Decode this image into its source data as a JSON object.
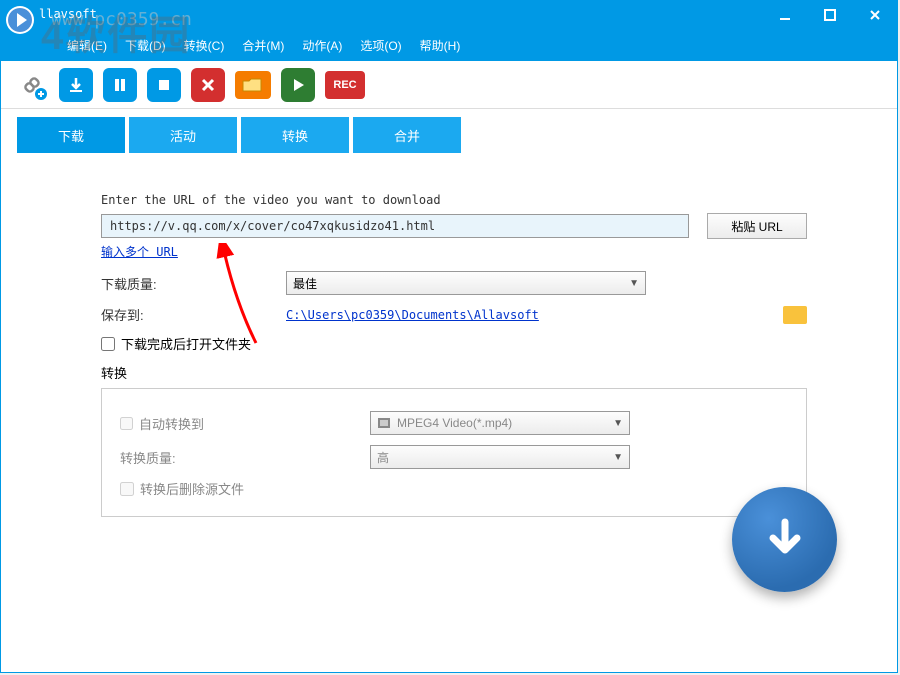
{
  "title": "llavsoft",
  "watermark_text": "4软件园",
  "watermark_url": "www.pc0359.cn",
  "menu": [
    "编辑(E)",
    "下载(D)",
    "转换(C)",
    "合并(M)",
    "动作(A)",
    "选项(O)",
    "帮助(H)"
  ],
  "toolbar_rec": "REC",
  "tabs": [
    "下载",
    "活动",
    "转换",
    "合并"
  ],
  "url_prompt": "Enter the URL of the video you want to download",
  "url_value": "https://v.qq.com/x/cover/co47xqkusidzo41.html",
  "paste_btn": "粘贴 URL",
  "multi_url_link": "输入多个 URL",
  "quality_label": "下载质量:",
  "quality_value": "最佳",
  "saveto_label": "保存到:",
  "saveto_path": "C:\\Users\\pc0359\\Documents\\Allavsoft",
  "open_after_label": "下载完成后打开文件夹",
  "convert_header": "转换",
  "auto_convert_label": "自动转换到",
  "convert_format": "MPEG4 Video(*.mp4)",
  "convert_quality_label": "转换质量:",
  "convert_quality_value": "高",
  "delete_source_label": "转换后删除源文件"
}
